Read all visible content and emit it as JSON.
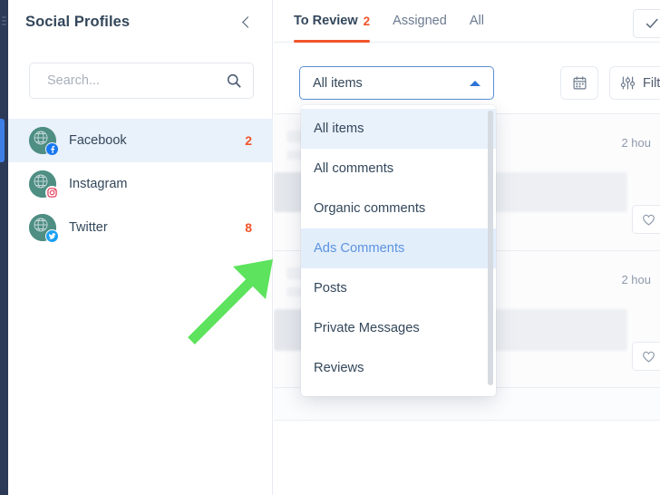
{
  "left_panel": {
    "title": "Social Profiles",
    "collapse_icon": "chevron-left-icon",
    "search": {
      "placeholder": "Search...",
      "value": "",
      "icon": "search-icon"
    },
    "profiles": [
      {
        "name": "Facebook",
        "count": "2",
        "network": "facebook",
        "badge_icon": "facebook-icon",
        "selected": true
      },
      {
        "name": "Instagram",
        "count": "",
        "network": "instagram",
        "badge_icon": "instagram-icon",
        "selected": false
      },
      {
        "name": "Twitter",
        "count": "8",
        "network": "twitter",
        "badge_icon": "twitter-icon",
        "selected": false
      }
    ]
  },
  "main": {
    "tabs": [
      {
        "label": "To Review",
        "count": "2",
        "active": true
      },
      {
        "label": "Assigned",
        "count": "",
        "active": false
      },
      {
        "label": "All",
        "count": "",
        "active": false
      }
    ],
    "check_all_icon": "check-icon",
    "toolbar": {
      "select_value": "All items",
      "select_caret_icon": "caret-up-icon",
      "calendar_icon": "calendar-icon",
      "filters_icon": "sliders-icon",
      "filters_label": "Filters"
    },
    "feed": [
      {
        "time": "2 hou",
        "like_icon": "heart-icon"
      },
      {
        "time": "2 hou",
        "like_icon": "heart-icon"
      }
    ]
  },
  "dropdown": {
    "open": true,
    "options": [
      {
        "label": "All items",
        "state": "selected"
      },
      {
        "label": "All comments",
        "state": "normal"
      },
      {
        "label": "Organic comments",
        "state": "normal"
      },
      {
        "label": "Ads Comments",
        "state": "highlighted"
      },
      {
        "label": "Posts",
        "state": "normal"
      },
      {
        "label": "Private Messages",
        "state": "normal"
      },
      {
        "label": "Reviews",
        "state": "normal"
      }
    ],
    "scrollbar": "dropdown-scrollbar"
  },
  "annotation": {
    "type": "arrow",
    "color": "#5de35d",
    "points_to": "Ads Comments"
  },
  "colors": {
    "accent_orange": "#f2542a",
    "accent_blue": "#3e7ee6",
    "text_dark": "#33475b",
    "rail_navy": "#2c3a57",
    "highlight_blue": "#e3eefb",
    "arrow_green": "#5de35d"
  }
}
